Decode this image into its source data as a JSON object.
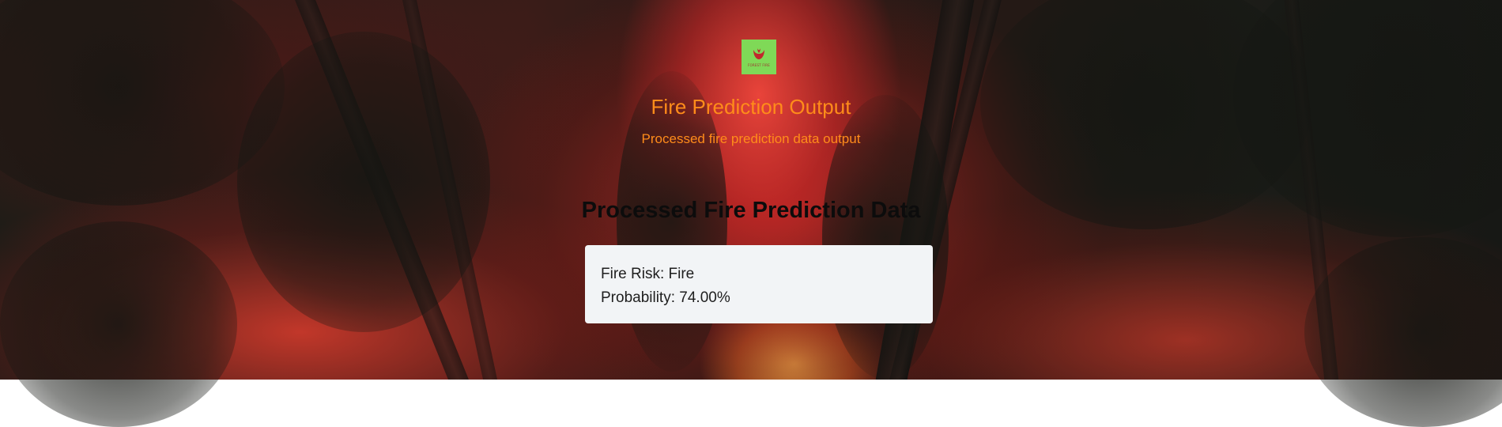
{
  "logo": {
    "name": "forest-fire-logo",
    "text": "FOREST FIRE",
    "background": "#7fd957",
    "icon": "flame-icon"
  },
  "header": {
    "title": "Fire Prediction Output",
    "subtitle": "Processed fire prediction data output"
  },
  "main": {
    "heading": "Processed Fire Prediction Data",
    "result": {
      "risk_label": "Fire Risk:",
      "risk_value": "Fire",
      "probability_label": "Probability:",
      "probability_value": "74.00%"
    }
  },
  "colors": {
    "accent": "#ff8c1a",
    "heading": "#0c0c0c",
    "card_background": "#f2f4f6"
  }
}
